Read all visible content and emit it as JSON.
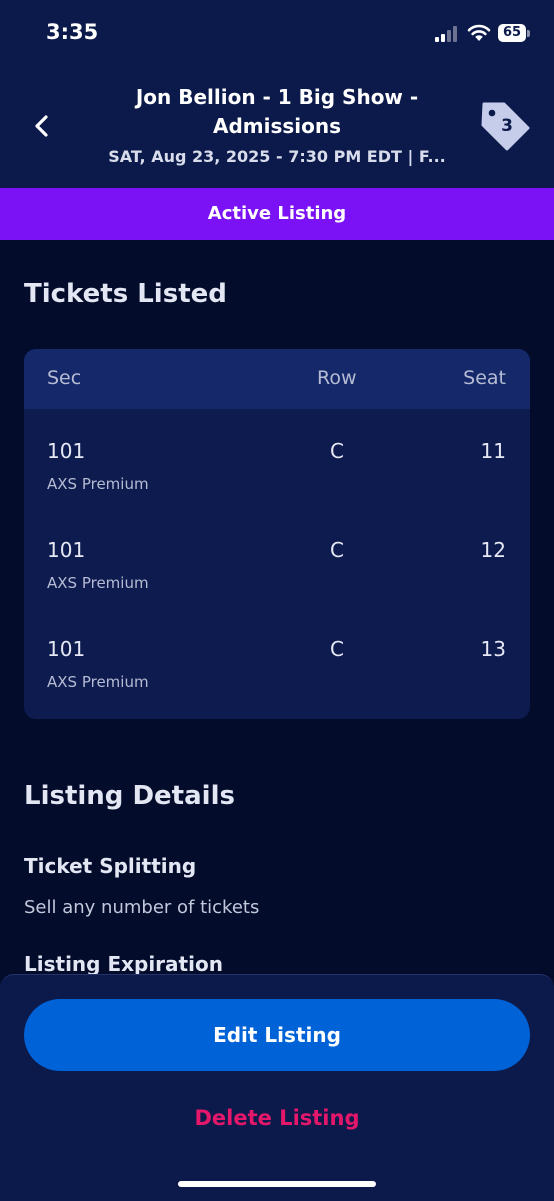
{
  "status_bar": {
    "time": "3:35",
    "battery": "65"
  },
  "header": {
    "title": "Jon Bellion - 1 Big Show - Admissions",
    "subtitle": "SAT, Aug 23, 2025 - 7:30 PM EDT | F...",
    "tag_count": "3",
    "icons": {
      "back": "chevron-left-icon",
      "tag": "price-tag-icon"
    }
  },
  "banner": {
    "label": "Active Listing",
    "color": "#7a12f5"
  },
  "tickets": {
    "title": "Tickets Listed",
    "columns": [
      "Sec",
      "Row",
      "Seat"
    ],
    "rows": [
      {
        "sec": "101",
        "type": "AXS Premium",
        "row": "C",
        "seat": "11"
      },
      {
        "sec": "101",
        "type": "AXS Premium",
        "row": "C",
        "seat": "12"
      },
      {
        "sec": "101",
        "type": "AXS Premium",
        "row": "C",
        "seat": "13"
      }
    ]
  },
  "details": {
    "title": "Listing Details",
    "ticket_splitting_label": "Ticket Splitting",
    "ticket_splitting_value": "Sell any number of tickets",
    "expiration_label": "Listing Expiration"
  },
  "actions": {
    "edit_label": "Edit Listing",
    "delete_label": "Delete Listing",
    "edit_color": "#0062d7",
    "delete_color": "#e4176b"
  }
}
